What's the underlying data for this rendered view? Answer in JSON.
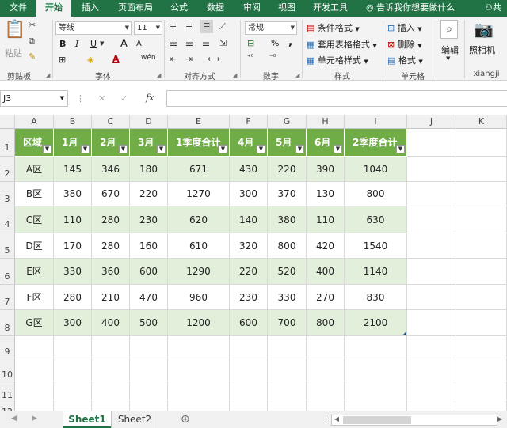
{
  "ribbon_tabs": [
    "文件",
    "开始",
    "插入",
    "页面布局",
    "公式",
    "数据",
    "审阅",
    "视图",
    "开发工具"
  ],
  "active_tab": "开始",
  "tell_me": "告诉我你想要做什么",
  "share": "共享",
  "clipboard": {
    "paste": "粘贴",
    "label": "剪贴板"
  },
  "font": {
    "name": "等线",
    "size": "11",
    "bold": "B",
    "italic": "I",
    "underline": "U",
    "grow": "A",
    "shrink": "A",
    "label": "字体",
    "wen": "wén"
  },
  "alignment": {
    "label": "对齐方式"
  },
  "number": {
    "format": "常规",
    "percent": "%",
    "comma": ",",
    "label": "数字"
  },
  "styles": {
    "conditional": "条件格式",
    "table": "套用表格格式",
    "cell": "单元格样式",
    "label": "样式"
  },
  "cells": {
    "insert": "插入",
    "delete": "删除",
    "format": "格式",
    "label": "单元格"
  },
  "editing": {
    "label": "编辑"
  },
  "camera": {
    "label": "照相机",
    "group": "xiangji"
  },
  "name_box": "J3",
  "fx": "fx",
  "columns": [
    "A",
    "B",
    "C",
    "D",
    "E",
    "F",
    "G",
    "H",
    "I",
    "J",
    "K"
  ],
  "rows": [
    "1",
    "2",
    "3",
    "4",
    "5",
    "6",
    "7",
    "8",
    "9",
    "10",
    "11",
    "12"
  ],
  "table": {
    "headers": [
      "区域",
      "1月",
      "2月",
      "3月",
      "1季度合计",
      "4月",
      "5月",
      "6月",
      "2季度合计"
    ],
    "data": [
      [
        "A区",
        "145",
        "346",
        "180",
        "671",
        "430",
        "220",
        "390",
        "1040"
      ],
      [
        "B区",
        "380",
        "670",
        "220",
        "1270",
        "300",
        "370",
        "130",
        "800"
      ],
      [
        "C区",
        "110",
        "280",
        "230",
        "620",
        "140",
        "380",
        "110",
        "630"
      ],
      [
        "D区",
        "170",
        "280",
        "160",
        "610",
        "320",
        "800",
        "420",
        "1540"
      ],
      [
        "E区",
        "330",
        "360",
        "600",
        "1290",
        "220",
        "520",
        "400",
        "1140"
      ],
      [
        "F区",
        "280",
        "210",
        "470",
        "960",
        "230",
        "330",
        "270",
        "830"
      ],
      [
        "G区",
        "300",
        "400",
        "500",
        "1200",
        "600",
        "700",
        "800",
        "2100"
      ]
    ],
    "header_color": "#70ad47",
    "band_color": "#e2efda"
  },
  "sheets": [
    "Sheet1",
    "Sheet2"
  ],
  "active_sheet": "Sheet1",
  "accent": "#217346"
}
